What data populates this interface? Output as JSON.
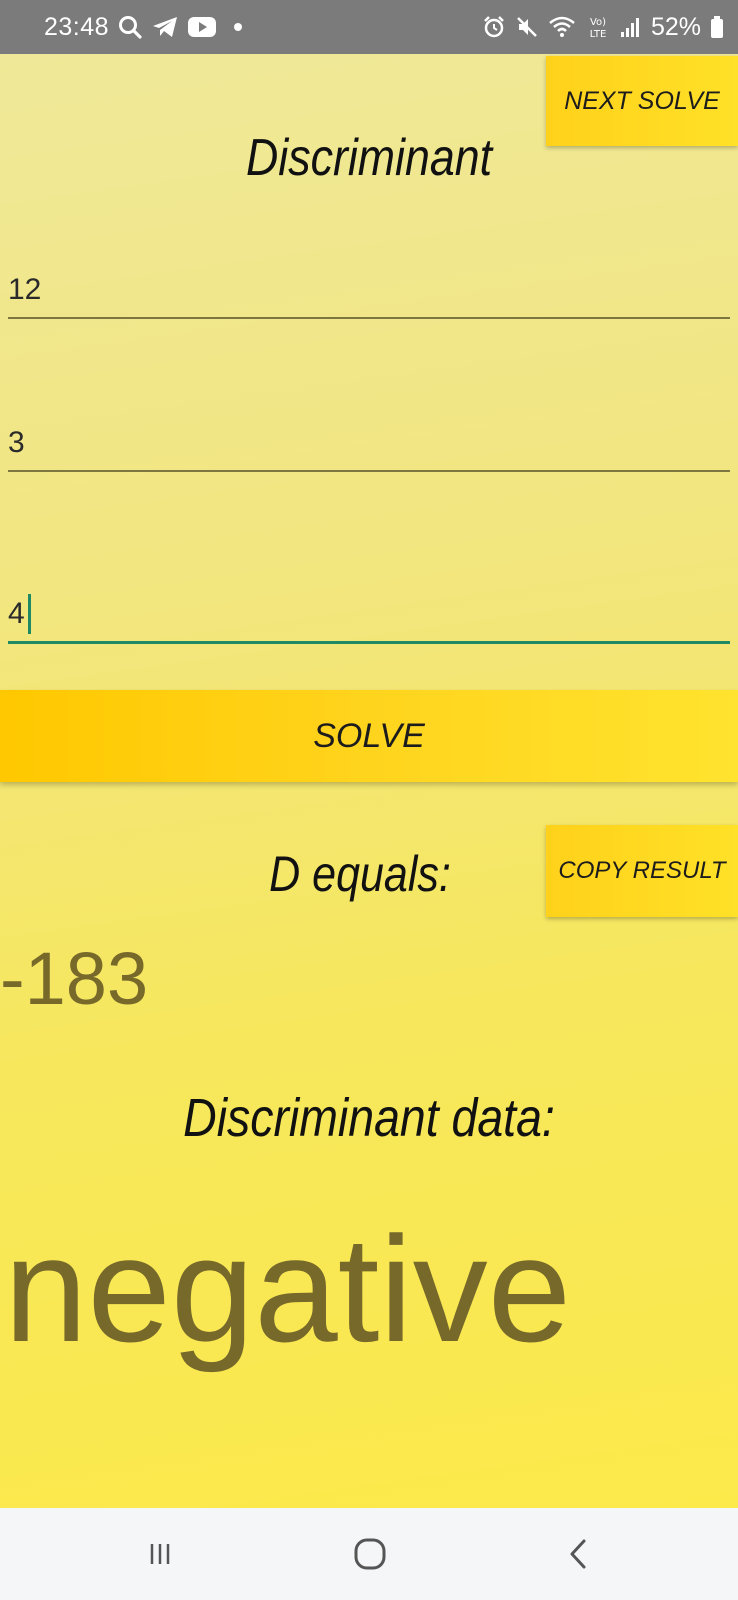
{
  "status_bar": {
    "time": "23:48",
    "battery_percent": "52%",
    "left_icons": [
      "search-icon",
      "telegram-icon",
      "youtube-icon",
      "dot-icon"
    ],
    "right_icons": [
      "alarm-icon",
      "mute-icon",
      "wifi-icon",
      "volte-icon",
      "signal-icon",
      "battery-icon"
    ]
  },
  "app": {
    "next_solve_label": "NEXT SOLVE",
    "title": "Discriminant",
    "inputs": {
      "a": "12",
      "b": "3",
      "c": "4"
    },
    "solve_label": "SOLVE",
    "d_equals_label": "D equals:",
    "copy_result_label": "COPY RESULT",
    "result_value": "-183",
    "data_label": "Discriminant data:",
    "data_value": "negative"
  },
  "colors": {
    "accent_button": "#ffd11a",
    "result_text": "#77692a",
    "focused_field": "#1f8a63"
  },
  "nav_bar": {
    "buttons": [
      "recents-icon",
      "home-icon",
      "back-icon"
    ]
  }
}
